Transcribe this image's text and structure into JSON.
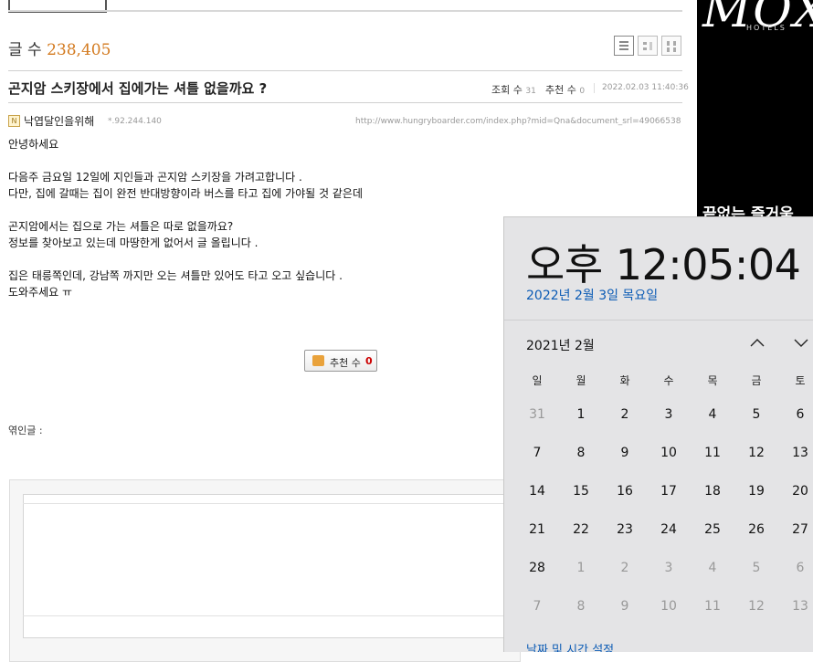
{
  "board": {
    "post_count_label": "글 수",
    "post_count": "238,405",
    "post": {
      "title": "곤지암 스키장에서 집에가는 셔틀 없을까요 ?",
      "views_label": "조회 수",
      "views": "31",
      "recommend_label": "추천 수",
      "recommend": "0",
      "date": "2022.02.03 11:40:36",
      "author": "낙엽달인을위해",
      "author_ip": "*.92.244.140",
      "url": "http://www.hungryboarder.com/index.php?mid=Qna&document_srl=49066538",
      "body_lines": [
        "안녕하세요",
        "",
        "다음주 금요일 12일에 지인들과 곤지암 스키장을 가려고합니다 .",
        "다만, 집에 갈때는 집이 완전 반대방향이라 버스를 타고 집에 가야될 것 같은데",
        "",
        "곤지암에서는 집으로 가는 셔틀은 따로 없을까요?",
        "정보를 찾아보고 있는데 마땅한게 없어서 글 올립니다 .",
        "",
        "집은 태릉쪽인데, 강남쪽 까지만 오는 셔틀만 있어도 타고 오고 싶습니다 .",
        "도와주세요 ㅠ"
      ],
      "recommend_button_label": "추천 수",
      "recommend_button_count": "0",
      "related_label": "엮인글 :"
    },
    "accent_color": "#d37a1f"
  },
  "ad": {
    "logo": "MOX",
    "hotels": "HOTELS",
    "tagline": "끝없는 즐거움"
  },
  "clock": {
    "time": "오후 12:05:04",
    "date": "2022년 2월 3일 목요일",
    "month": "2021년 2월",
    "prev_icon": "chevron-up-icon",
    "next_icon": "chevron-down-icon",
    "weekdays": [
      "일",
      "월",
      "화",
      "수",
      "목",
      "금",
      "토"
    ],
    "days": [
      [
        "31",
        "1",
        "2",
        "3",
        "4",
        "5",
        "6"
      ],
      [
        "7",
        "8",
        "9",
        "10",
        "11",
        "12",
        "13"
      ],
      [
        "14",
        "15",
        "16",
        "17",
        "18",
        "19",
        "20"
      ],
      [
        "21",
        "22",
        "23",
        "24",
        "25",
        "26",
        "27"
      ],
      [
        "28",
        "1",
        "2",
        "3",
        "4",
        "5",
        "6"
      ],
      [
        "7",
        "8",
        "9",
        "10",
        "11",
        "12",
        "13"
      ]
    ],
    "settings_link": "날짜 및 시간 설정",
    "link_color": "#0b5bb5"
  }
}
